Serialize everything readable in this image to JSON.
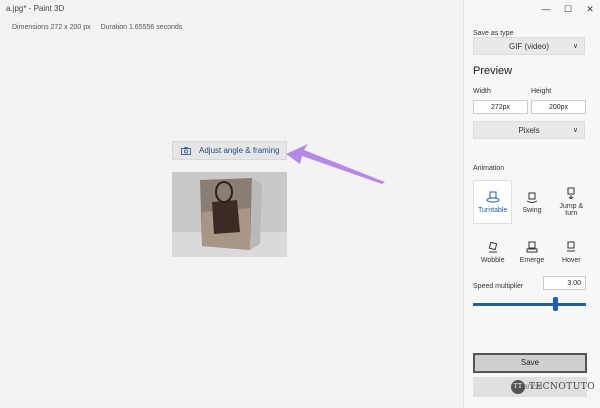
{
  "window": {
    "title": "a.jpg* - Paint 3D"
  },
  "info": {
    "dimensions": "Dimensions 272 x 200 px",
    "duration": "Duration 1.65556 seconds"
  },
  "canvas": {
    "adjust_label": "Adjust angle & framing"
  },
  "panel": {
    "save_as_type_label": "Save as type",
    "save_as_type_value": "GIF (video)",
    "preview_heading": "Preview",
    "width_label": "Width",
    "height_label": "Height",
    "width_value": "272px",
    "height_value": "200px",
    "units_value": "Pixels",
    "animation_label": "Animation",
    "animations": [
      {
        "label": "Turntable",
        "icon": "turntable-icon"
      },
      {
        "label": "Swing",
        "icon": "swing-icon"
      },
      {
        "label": "Jump &\nturn",
        "icon": "jump-turn-icon"
      },
      {
        "label": "Wobble",
        "icon": "wobble-icon"
      },
      {
        "label": "Emerge",
        "icon": "emerge-icon"
      },
      {
        "label": "Hover",
        "icon": "hover-icon"
      }
    ],
    "speed_label": "Speed multiplier",
    "speed_value": "3.00",
    "save_label": "Save",
    "cancel_label": "Cancel"
  },
  "watermark": {
    "text": "TECNOTUTO"
  },
  "colors": {
    "accent": "#1f5fa8",
    "arrow": "#b58ae6"
  }
}
